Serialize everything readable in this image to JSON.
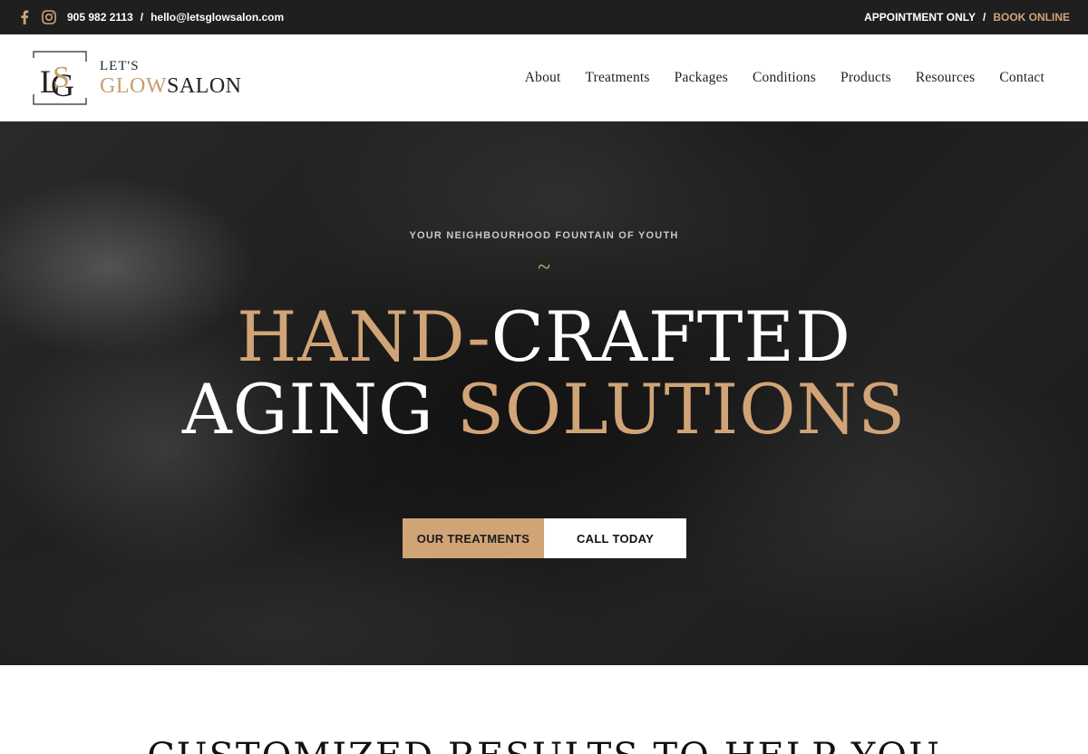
{
  "topbar": {
    "phone": "905 982 2113",
    "separator": "/",
    "email": "hello@letsglowsalon.com",
    "appointment": "APPOINTMENT ONLY",
    "book_online": "BOOK ONLINE",
    "icons": [
      "facebook-icon",
      "instagram-icon"
    ]
  },
  "logo": {
    "monogram": "LGS",
    "lets": "LET'S",
    "glow": "GLOW",
    "salon": "SALON"
  },
  "nav": {
    "items": [
      "About",
      "Treatments",
      "Packages",
      "Conditions",
      "Products",
      "Resources",
      "Contact"
    ]
  },
  "hero": {
    "tagline": "YOUR NEIGHBOURHOOD FOUNTAIN OF YOUTH",
    "tilde": "~",
    "headline": {
      "line1_gold": "HAND-",
      "line1_white": "CRAFTED",
      "line2_white": "AGING ",
      "line2_gold": "SOLUTIONS"
    },
    "buttons": {
      "treatments": "OUR TREATMENTS",
      "call": "CALL TODAY"
    }
  },
  "section": {
    "title": "CUSTOMIZED RESULTS TO HELP YOU"
  },
  "colors": {
    "accent": "#d1a477",
    "topbar_bg": "#1f1f1f",
    "hero_bg": "#1e1e1e"
  }
}
